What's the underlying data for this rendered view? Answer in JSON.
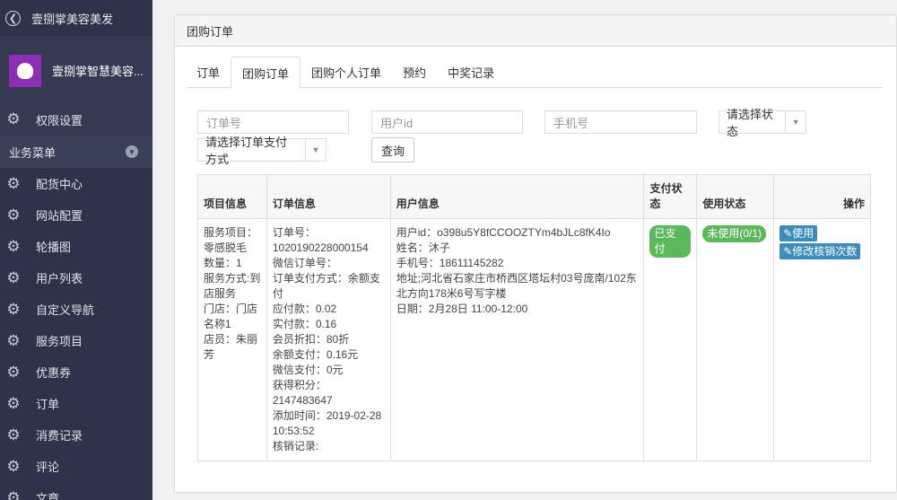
{
  "sidebar": {
    "title": "壹捌掌美容美发",
    "brand_name": "壹捌掌智慧美容...",
    "permission": "权限设置",
    "section": "业务菜单",
    "items": [
      "配货中心",
      "网站配置",
      "轮播图",
      "用户列表",
      "自定义导航",
      "服务项目",
      "优惠券",
      "订单",
      "消费记录",
      "评论",
      "文章"
    ]
  },
  "panel": {
    "title": "团购订单",
    "tabs": [
      "订单",
      "团购订单",
      "团购个人订单",
      "预约",
      "中奖记录"
    ]
  },
  "filters": {
    "order_no_placeholder": "订单号",
    "user_id_placeholder": "用户id",
    "phone_placeholder": "手机号",
    "status_select": "请选择状态",
    "pay_method_select": "请选择订单支付方式",
    "query_button": "查询"
  },
  "table": {
    "headers": [
      "项目信息",
      "订单信息",
      "用户信息",
      "支付状态",
      "使用状态",
      "操作"
    ],
    "row": {
      "project": [
        "服务项目：零感脱毛",
        "数量：1",
        "服务方式:到店服务",
        "门店：门店名称1",
        "店员：朱丽芳"
      ],
      "order": [
        "订单号：1020190228000154",
        "微信订单号：",
        "订单支付方式：余额支付",
        "应付款：0.02",
        "实付款：0.16",
        "会员折扣：80折",
        "余额支付：0.16元",
        "微信支付：0元",
        "获得积分：2147483647",
        "添加时间：2019-02-28 10:53:52",
        "核销记录:"
      ],
      "user": [
        "用户id：o398u5Y8fCCOOZTYm4bJLc8fK4Io",
        "姓名：沐子",
        "手机号：18611145282",
        "地址;河北省石家庄市桥西区塔坛村03号庞南/102东北方向178米6号写字楼",
        "日期：2月28日 11:00-12:00"
      ],
      "pay_status": "已支付",
      "use_status": "未使用(0/1)",
      "op_use": "使用",
      "op_edit": "修改核销次数"
    }
  },
  "colors": {
    "sidebar_bg": "#2f3349",
    "badge_green": "#5cb85c",
    "btn_blue": "#3c8dbc"
  }
}
